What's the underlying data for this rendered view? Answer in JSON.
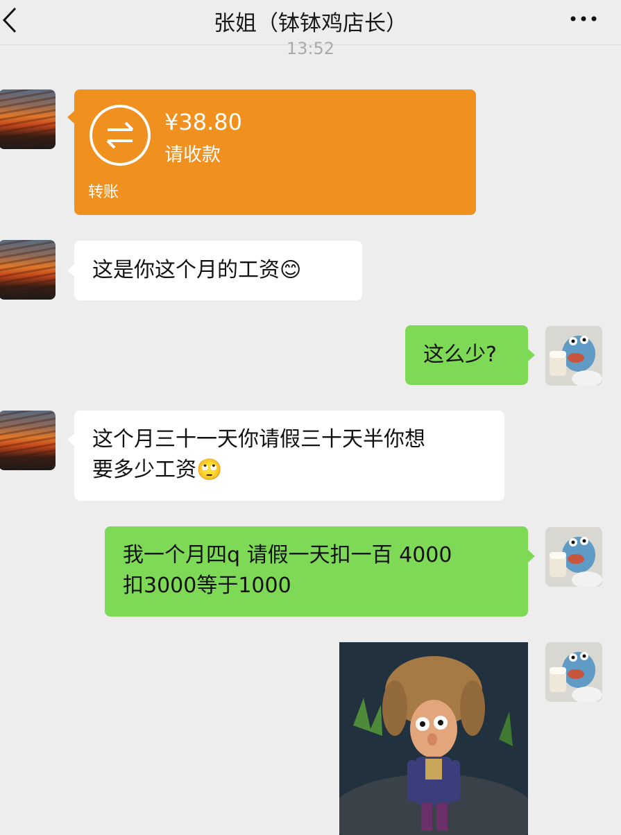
{
  "header": {
    "title": "张姐（钵钵鸡店长）",
    "back_icon": "chevron-left-icon",
    "more_icon": "more-dots-icon"
  },
  "timestamp": "13:52",
  "colors": {
    "background": "#ededed",
    "sent_bubble": "#7ed957",
    "received_bubble": "#ffffff",
    "transfer_card": "#f0901f"
  },
  "messages": [
    {
      "sender": "张姐",
      "type": "transfer",
      "amount": "¥38.80",
      "status": "请收款",
      "label": "转账"
    },
    {
      "sender": "张姐",
      "type": "text",
      "text": "这是你这个月的工资",
      "emoji": "😊"
    },
    {
      "sender": "me",
      "type": "text",
      "text": "这么少?"
    },
    {
      "sender": "张姐",
      "type": "text",
      "line1": "这个月三十一天你请假三十天半你想",
      "line2": "要多少工资",
      "emoji": "🙄"
    },
    {
      "sender": "me",
      "type": "text",
      "line1": "我一个月四q 请假一天扣一百 4000",
      "line2": "扣3000等于1000"
    },
    {
      "sender": "me",
      "type": "sticker",
      "sticker_name": "cartoon-character-sticker"
    }
  ]
}
